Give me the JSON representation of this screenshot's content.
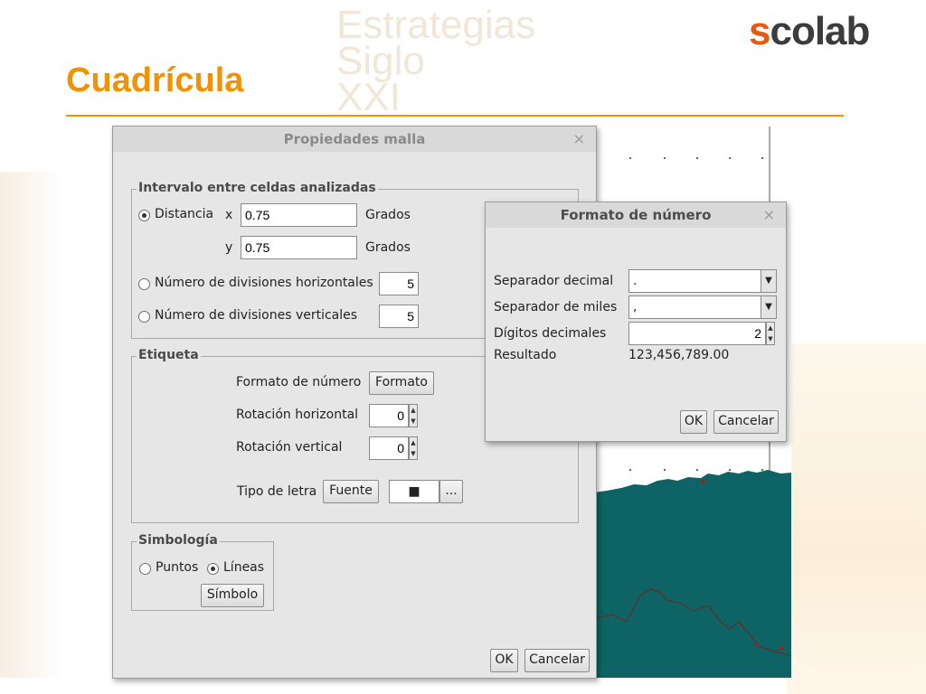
{
  "slide": {
    "title": "Cuadrícula",
    "watermark": "Estrategias\nSiglo\nXXI",
    "logo_main": "colab",
    "logo_prefix": "s",
    "accent_color": "#f39200"
  },
  "propiedades": {
    "title": "Propiedades malla",
    "close": "×",
    "intervalo": {
      "legend": "Intervalo entre celdas analizadas",
      "distancia_label": "Distancia",
      "x_label": "x",
      "x_value": "0.75",
      "y_label": "y",
      "y_value": "0.75",
      "unit": "Grados",
      "hdiv_label": "Número de divisiones horizontales",
      "hdiv_value": "5",
      "vdiv_label": "Número de divisiones verticales",
      "vdiv_value": "5"
    },
    "etiqueta": {
      "legend": "Etiqueta",
      "formato_label": "Formato de número",
      "formato_button": "Formato",
      "rot_h_label": "Rotación horizontal",
      "rot_h_value": "0",
      "rot_v_label": "Rotación vertical",
      "rot_v_value": "0",
      "tipo_letra_label": "Tipo de letra",
      "fuente_button": "Fuente",
      "color_swatch": "■",
      "more_button": "..."
    },
    "simbologia": {
      "legend": "Simbología",
      "puntos": "Puntos",
      "lineas": "Líneas",
      "simbolo_button": "Símbolo"
    },
    "ok": "OK",
    "cancel": "Cancelar"
  },
  "formato": {
    "title": "Formato de número",
    "close": "×",
    "sep_decimal_label": "Separador decimal",
    "sep_decimal_value": ".",
    "sep_miles_label": "Separador de miles",
    "sep_miles_value": ",",
    "digitos_label": "Dígitos decimales",
    "digitos_value": "2",
    "resultado_label": "Resultado",
    "resultado_value": "123,456,789.00",
    "ok": "OK",
    "cancel": "Cancelar"
  },
  "map": {
    "sea_color": "#0e6464",
    "line_color": "#7a1f1f"
  }
}
